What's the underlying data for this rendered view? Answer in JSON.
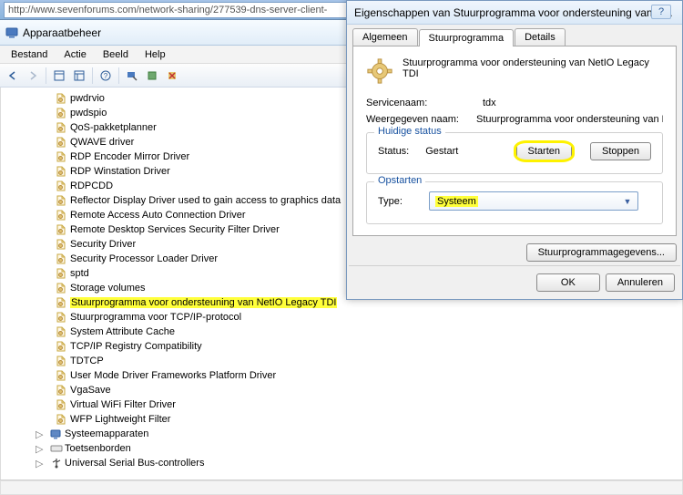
{
  "url": "http://www.sevenforums.com/network-sharing/277539-dns-server-client-",
  "window_title": "Apparaatbeheer",
  "menu": {
    "file": "Bestand",
    "action": "Actie",
    "view": "Beeld",
    "help": "Help"
  },
  "tree": {
    "items": [
      "pwdrvio",
      "pwdspio",
      "QoS-pakketplanner",
      "QWAVE driver",
      "RDP Encoder Mirror Driver",
      "RDP Winstation Driver",
      "RDPCDD",
      "Reflector Display Driver used to gain access to graphics data",
      "Remote Access Auto Connection Driver",
      "Remote Desktop Services Security Filter Driver",
      "Security Driver",
      "Security Processor Loader Driver",
      "sptd",
      "Storage volumes",
      "Stuurprogramma voor ondersteuning van NetIO Legacy TDI",
      "Stuurprogramma voor TCP/IP-protocol",
      "System Attribute Cache",
      "TCP/IP Registry Compatibility",
      "TDTCP",
      "User Mode Driver Frameworks Platform Driver",
      "VgaSave",
      "Virtual WiFi Filter Driver",
      "WFP Lightweight Filter"
    ],
    "highlighted_index": 14,
    "categories": [
      "Systeemapparaten",
      "Toetsenborden",
      "Universal Serial Bus-controllers"
    ]
  },
  "dialog": {
    "title": "Eigenschappen van Stuurprogramma voor ondersteuning van N...",
    "tabs": {
      "general": "Algemeen",
      "driver": "Stuurprogramma",
      "details": "Details"
    },
    "header_text": "Stuurprogramma voor ondersteuning van NetIO Legacy TDI",
    "service_label": "Servicenaam:",
    "service_value": "tdx",
    "display_label": "Weergegeven naam:",
    "display_value": "Stuurprogramma voor ondersteuning van Ne",
    "status_group": "Huidige status",
    "status_label": "Status:",
    "status_value": "Gestart",
    "start_btn": "Starten",
    "stop_btn": "Stoppen",
    "startup_group": "Opstarten",
    "type_label": "Type:",
    "type_value": "Systeem",
    "driver_data_btn": "Stuurprogrammagegevens...",
    "ok": "OK",
    "cancel": "Annuleren"
  }
}
